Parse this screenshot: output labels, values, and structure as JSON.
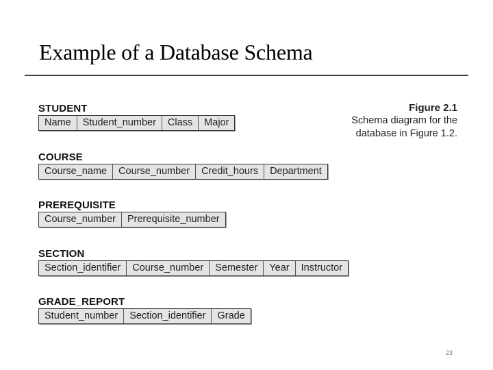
{
  "slide": {
    "title": "Example of a Database Schema",
    "page_number": "23"
  },
  "figure": {
    "number": "Figure 2.1",
    "caption_line1": "Schema diagram for the",
    "caption_line2": "database in Figure 1.2."
  },
  "relations": [
    {
      "name": "STUDENT",
      "attributes": [
        "Name",
        "Student_number",
        "Class",
        "Major"
      ]
    },
    {
      "name": "COURSE",
      "attributes": [
        "Course_name",
        "Course_number",
        "Credit_hours",
        "Department"
      ]
    },
    {
      "name": "PREREQUISITE",
      "attributes": [
        "Course_number",
        "Prerequisite_number"
      ]
    },
    {
      "name": "SECTION",
      "attributes": [
        "Section_identifier",
        "Course_number",
        "Semester",
        "Year",
        "Instructor"
      ]
    },
    {
      "name": "GRADE_REPORT",
      "attributes": [
        "Student_number",
        "Section_identifier",
        "Grade"
      ]
    }
  ]
}
